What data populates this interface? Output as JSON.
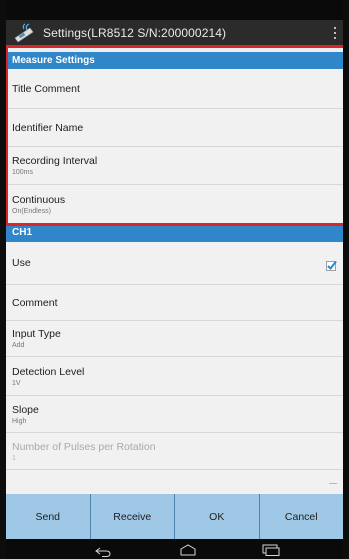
{
  "window": {
    "title": "Settings(LR8512 S/N:200000214)"
  },
  "icons": {
    "app": "wireless-logger-icon",
    "overflow": "overflow-menu-icon",
    "checkbox": "checkbox-checked-icon",
    "back": "back-icon",
    "home": "home-icon",
    "recent": "recent-apps-icon"
  },
  "colors": {
    "section_header": "#2f86c9",
    "highlight_border": "#d8262b",
    "button_bar": "#9ec8e6",
    "check": "#2f86c9"
  },
  "measure_settings": {
    "header": "Measure Settings",
    "items": [
      {
        "title": "Title Comment"
      },
      {
        "title": "Identifier Name"
      },
      {
        "title": "Recording Interval",
        "value": "100ms"
      },
      {
        "title": "Continuous",
        "value": "On(Endless)"
      }
    ]
  },
  "ch1": {
    "header": "CH1",
    "use": {
      "title": "Use",
      "checked": true
    },
    "items": [
      {
        "title": "Comment"
      },
      {
        "title": "Input Type",
        "value": "Add"
      },
      {
        "title": "Detection Level",
        "value": "1V"
      },
      {
        "title": "Slope",
        "value": "High"
      },
      {
        "title": "Number of Pulses per Rotation",
        "value": "1",
        "disabled": true
      }
    ]
  },
  "buttons": {
    "send": "Send",
    "receive": "Receive",
    "ok": "OK",
    "cancel": "Cancel"
  }
}
